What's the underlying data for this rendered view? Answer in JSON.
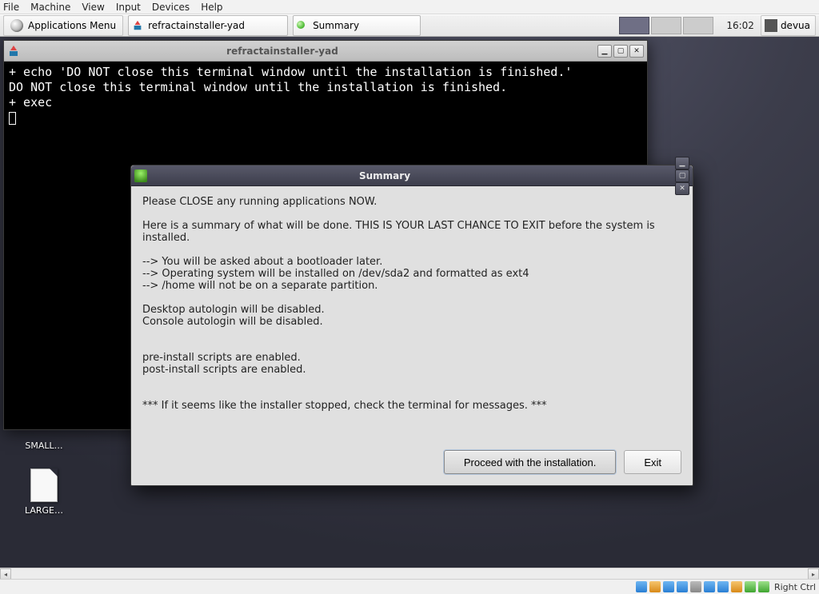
{
  "vm_menu": {
    "items": [
      "File",
      "Machine",
      "View",
      "Input",
      "Devices",
      "Help"
    ]
  },
  "panel": {
    "apps_label": "Applications Menu",
    "task1": "refractainstaller-yad",
    "task2": "Summary",
    "clock": "16:02",
    "username": "devua"
  },
  "desktop_icons": {
    "small": "SMALL…",
    "large": "LARGE…"
  },
  "terminal": {
    "title": "refractainstaller-yad",
    "line1": "+ echo 'DO NOT close this terminal window until the installation is finished.'",
    "line2": "DO NOT close this terminal window until the installation is finished.",
    "line3": "+ exec"
  },
  "dialog": {
    "title": "Summary",
    "p1": "Please CLOSE any running applications NOW.",
    "p2": "Here is a summary of what will be done. THIS IS YOUR LAST CHANCE TO EXIT before the system is installed.",
    "b1": "--> You will be asked about a bootloader later.",
    "b2": "--> Operating system will be installed on /dev/sda2 and formatted as ext4",
    "b3": "--> /home will not be on a separate partition.",
    "p3a": "Desktop autologin will be disabled.",
    "p3b": "Console autologin will be disabled.",
    "p4a": "pre-install scripts are enabled.",
    "p4b": "post-install scripts are enabled.",
    "p5": "*** If it seems like the installer stopped, check the terminal for messages. ***",
    "btn_proceed": "Proceed with the installation.",
    "btn_exit": "Exit"
  },
  "vm_status": {
    "key_text": "Right Ctrl"
  }
}
